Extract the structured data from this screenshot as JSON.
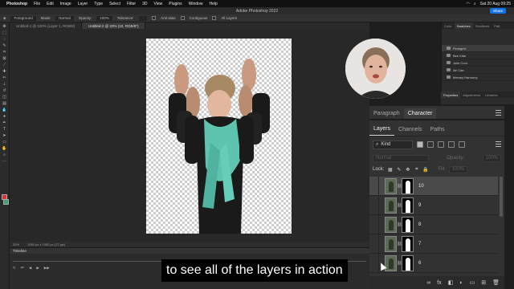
{
  "menubar": {
    "app": "Photoshop",
    "items": [
      "File",
      "Edit",
      "Image",
      "Layer",
      "Type",
      "Select",
      "Filter",
      "3D",
      "View",
      "Plugins",
      "Window",
      "Help"
    ],
    "datetime": "Sat 20 Aug 09:25"
  },
  "titlebar": {
    "title": "Adobe Photoshop 2022",
    "share_label": "Share"
  },
  "options": {
    "sample": "Foreground",
    "mode_label": "Mode:",
    "mode_value": "Normal",
    "opacity_label": "Opacity:",
    "opacity_value": "100%",
    "tolerance_label": "Tolerance:",
    "antialias": "Anti-alias",
    "contiguous": "Contiguous",
    "all_layers": "All Layers"
  },
  "tabs": [
    {
      "label": "Untitled-1 @ 100% (Layer 1, RGB/8)"
    },
    {
      "label": "Untitled-2 @ 33% (10, RGB/8*)"
    }
  ],
  "status": {
    "zoom": "33%",
    "size": "1080 px x 1080 px (72 ppi)"
  },
  "timeline": {
    "title": "Timeline"
  },
  "right_top": {
    "tabs": [
      "Color",
      "Swatches",
      "Gradients",
      "Patt"
    ],
    "items": [
      "Pexegrid",
      "Bee Kids",
      "Julie Cron",
      "Air Carr",
      "Mersey Harmony"
    ]
  },
  "properties": {
    "tabs": [
      "Properties",
      "Adjustments",
      "Libraries"
    ]
  },
  "panel_pc": {
    "tabs": [
      "Paragraph",
      "Character"
    ]
  },
  "layers_panel": {
    "tabs": [
      "Layers",
      "Channels",
      "Paths"
    ],
    "kind_label": "Kind",
    "blend_mode": "Normal",
    "opacity_label": "Opacity:",
    "opacity_value": "100%",
    "lock_label": "Lock:",
    "fill_label": "Fill:",
    "fill_value": "100%",
    "layers": [
      "10",
      "9",
      "8",
      "7",
      "6"
    ],
    "footer_icons": [
      "link-icon",
      "fx-icon",
      "mask-icon",
      "adjustment-icon",
      "group-icon",
      "new-layer-icon",
      "trash-icon"
    ],
    "footer": {
      "link": "∞",
      "fx": "fx",
      "mask": "◧",
      "adjustment": "◐",
      "group": "▭",
      "new": "⊞",
      "trash": "🗑"
    }
  },
  "caption": "to see all of the layers in action",
  "colors": {
    "accent": "#1473e6",
    "scarf": "#5ec4b0",
    "panel": "#323232"
  }
}
